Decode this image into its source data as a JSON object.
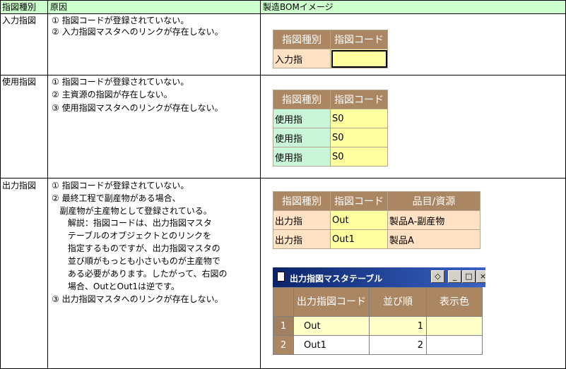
{
  "headers": {
    "type": "指図種別",
    "cause": "原因",
    "bom": "製造BOMイメージ"
  },
  "rows": [
    {
      "type": "入力指図",
      "reasons": [
        "① 指図コードが登録されていない。",
        "② 入力指図マスタへのリンクが存在しない。"
      ]
    },
    {
      "type": "使用指図",
      "reasons": [
        "① 指図コードが登録されていない。",
        "② 主資源の指図が存在しない。",
        "③ 使用指図マスタへのリンクが存在しない。"
      ]
    },
    {
      "type": "出力指図",
      "reasons": [
        "① 指図コードが登録されていない。",
        "② 最終工程で副産物がある場合、",
        "   副産物が主産物として登録されている。",
        "      解説：指図コードは、出力指図マスタ",
        "      テーブルのオブジェクトとのリンクを",
        "      指定するものですが、出力指図マスタの",
        "      並び順がもっとも小さいものが主産物で",
        "      ある必要があります。したがって、右図の",
        "      場合、OutとOut1は逆です。",
        "③ 出力指図マスタへのリンクが存在しない。"
      ]
    }
  ],
  "table1": {
    "headers": [
      "指図種別",
      "指図コード"
    ],
    "rows": [
      [
        "入力指",
        ""
      ]
    ]
  },
  "table2": {
    "headers": [
      "指図種別",
      "指図コード"
    ],
    "rows": [
      [
        "使用指",
        "S0"
      ],
      [
        "使用指",
        "S0"
      ],
      [
        "使用指",
        "S0"
      ]
    ]
  },
  "table3": {
    "headers": [
      "指図種別",
      "指図コード",
      "品目/資源"
    ],
    "rows": [
      [
        "出力指",
        "Out",
        "製品A-副産物"
      ],
      [
        "出力指",
        "Out1",
        "製品A"
      ]
    ]
  },
  "window": {
    "title": "出力指図マスタテーブル",
    "columns": [
      "出力指図コード",
      "並び順",
      "表示色"
    ],
    "rows": [
      {
        "num": "1",
        "code": "Out",
        "order": "1"
      },
      {
        "num": "2",
        "code": "Out1",
        "order": "2"
      }
    ]
  },
  "colors": {
    "header_bg": "#ccffcc",
    "table_header": "#ab8662",
    "peach": "#ffe1c4",
    "mint": "#c9f5d8",
    "yellow": "#ffffa0",
    "titlebar": "#0a246a"
  }
}
